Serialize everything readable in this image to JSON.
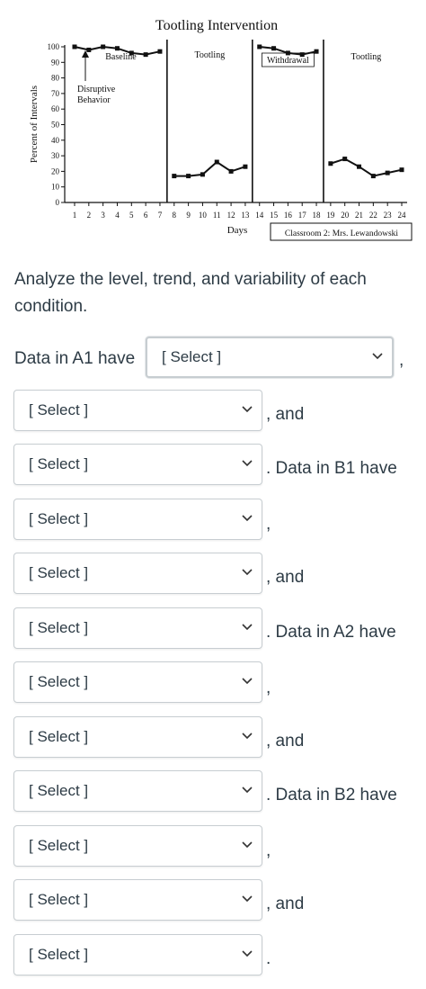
{
  "chart_data": {
    "type": "line",
    "title": "Tootling Intervention",
    "xlabel": "Days",
    "ylabel": "Percent of Intervals",
    "xlim": [
      1,
      24
    ],
    "ylim": [
      0,
      100
    ],
    "x_ticks": [
      "1",
      "2",
      "3",
      "4",
      "5",
      "6",
      "7",
      "8",
      "9",
      "10",
      "11",
      "12",
      "13",
      "14",
      "15",
      "16",
      "17",
      "18",
      "19",
      "20",
      "21",
      "22",
      "23",
      "24"
    ],
    "y_ticks": [
      "0",
      "10",
      "20",
      "30",
      "40",
      "50",
      "60",
      "70",
      "80",
      "90",
      "100"
    ],
    "phases": [
      {
        "label": "Baseline",
        "start": 1,
        "end": 7
      },
      {
        "label": "Tootling",
        "start": 8,
        "end": 13
      },
      {
        "label": "Withdrawal",
        "start": 14,
        "end": 18
      },
      {
        "label": "Tootling",
        "start": 19,
        "end": 24
      }
    ],
    "phase_lines_after": [
      7.5,
      13.5,
      18.5
    ],
    "series": [
      {
        "name": "Disruptive Behavior",
        "segments": [
          {
            "x": [
              1,
              2,
              3,
              4,
              5,
              6,
              7
            ],
            "y": [
              100,
              98,
              100,
              99,
              96,
              95,
              97
            ]
          },
          {
            "x": [
              8,
              9,
              10,
              11,
              12,
              13
            ],
            "y": [
              17,
              17,
              18,
              26,
              20,
              23
            ]
          },
          {
            "x": [
              14,
              15,
              16,
              17,
              18
            ],
            "y": [
              100,
              99,
              96,
              95,
              97
            ]
          },
          {
            "x": [
              19,
              20,
              21,
              22,
              23,
              24
            ],
            "y": [
              25,
              28,
              23,
              17,
              19,
              21
            ]
          }
        ]
      }
    ],
    "annotation": "Disruptive Behavior",
    "caption": "Classroom 2: Mrs. Lewandowski",
    "grid": false,
    "legend": "none"
  },
  "question": {
    "prompt": "Analyze the level, trend, and variability of each condition.",
    "lead_a1": "Data in A1 have",
    "comma": ",",
    "and": ", and",
    "b1_text": ". Data in B1 have",
    "a2_text": ". Data in A2 have",
    "b2_text": ". Data in B2 have",
    "period": ".",
    "selects": [
      "[ Select ]",
      "[ Select ]",
      "[ Select ]",
      "[ Select ]",
      "[ Select ]",
      "[ Select ]",
      "[ Select ]",
      "[ Select ]",
      "[ Select ]",
      "[ Select ]",
      "[ Select ]",
      "[ Select ]"
    ]
  },
  "icons": {
    "dropdown": "chevron-down-icon"
  },
  "colors": {
    "text": "#2d3b45",
    "border": "#c7cdd1",
    "chart_ink": "#111111"
  }
}
